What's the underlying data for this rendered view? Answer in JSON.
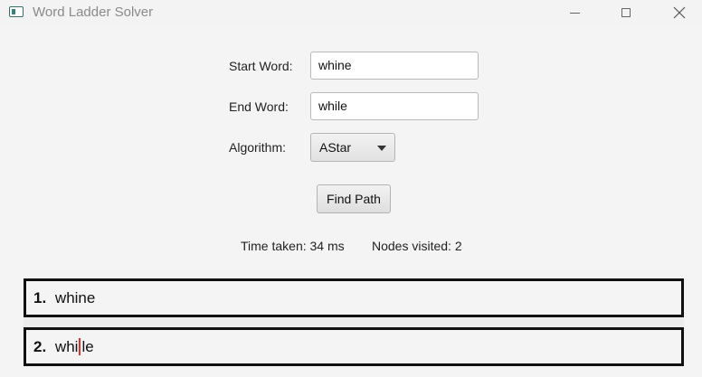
{
  "window": {
    "title": "Word Ladder Solver",
    "controls": [
      "minimize",
      "maximize",
      "close"
    ]
  },
  "form": {
    "start_label": "Start Word:",
    "start_value": "whine",
    "end_label": "End Word:",
    "end_value": "while",
    "algorithm_label": "Algorithm:",
    "algorithm_value": "AStar",
    "find_button": "Find Path"
  },
  "stats": {
    "time_label": "Time taken: 34 ms",
    "nodes_label": "Nodes visited: 2"
  },
  "results": [
    {
      "index": "1.",
      "word": "whine",
      "prefix": "whine",
      "changed": "",
      "suffix": ""
    },
    {
      "index": "2.",
      "word": "while",
      "prefix": "whi",
      "changed": "l",
      "suffix": "e"
    }
  ],
  "colors": {
    "highlight": "#e03030",
    "border": "#111111",
    "background": "#f4f4f4"
  }
}
